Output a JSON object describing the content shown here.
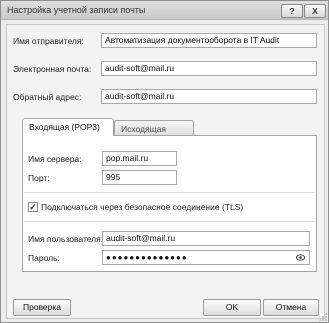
{
  "window": {
    "title": "Настройка учетной записи почты",
    "help_label": "?",
    "close_label": "X"
  },
  "sender": {
    "label": "Имя отправителя:",
    "value": "Автоматизация документооборота в IT Audit"
  },
  "email": {
    "label": "Электронная почта:",
    "value": "audit-soft@mail.ru"
  },
  "reply_to": {
    "label": "Обратный адрес:",
    "value": "audit-soft@mail.ru"
  },
  "tabs": [
    {
      "label": "Входящая (POP3)",
      "active": true
    },
    {
      "label": "Исходящая (SMTP)",
      "active": false
    }
  ],
  "incoming": {
    "server_label": "Имя сервера:",
    "server_value": "pop.mail.ru",
    "port_label": "Порт:",
    "port_value": "995",
    "tls_label": "Подключаться через безопасное соединение (TLS)",
    "tls_checked": "✓",
    "username_label": "Имя пользователя:",
    "username_value": "audit-soft@mail.ru",
    "password_label": "Пароль:",
    "password_value": "●●●●●●●●●●●●●●"
  },
  "buttons": {
    "check": "Проверка",
    "ok": "OK",
    "cancel": "Отмена"
  },
  "icons": {
    "password_toggle": "eye-icon",
    "resize": "resize-grip-icon"
  }
}
